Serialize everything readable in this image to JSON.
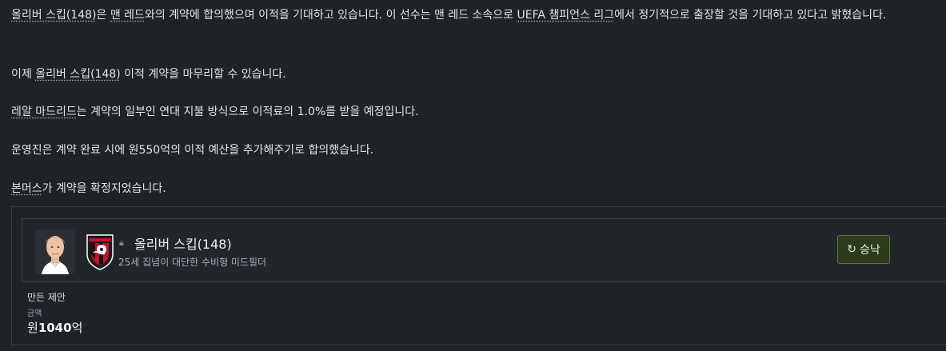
{
  "messages": {
    "p1": {
      "name": "올리버 스킵(148)",
      "tail_a": "은 ",
      "club": "맨 레드",
      "tail_b": "와의 계약에 합의했으며 이적을 기대하고 있습니다. 이 선수는 맨 레드 소속으로 ",
      "competition": "UEFA 챔피언스 리그",
      "tail_c": "에서 정기적으로 출장할 것을 기대하고 있다고 밝혔습니다."
    },
    "p2": {
      "head": "이제 ",
      "name": "올리버 스킵(148)",
      "tail": " 이적 계약을 마무리할 수 있습니다."
    },
    "p3": {
      "club": "레알 마드리드",
      "tail": "는 계약의 일부인 연대 지불 방식으로 이적료의 1.0%를 받을 예정입니다."
    },
    "p4": {
      "text": "운영진은 계약 완료 시에 원550억의 이적 예산을 추가해주기로 합의했습니다."
    },
    "p5": {
      "club": "본머스",
      "tail": "가 계약을 확정지었습니다."
    }
  },
  "card": {
    "player_name": "올리버 스킵(148)",
    "player_desc": "25세 집념이 대단한 수비형 미드필더",
    "accept_label": "승낙",
    "offer_title": "만든 제안",
    "amount_label": "금액",
    "amount_prefix": "원",
    "amount_value": "1040",
    "amount_suffix": "억"
  },
  "icons": {
    "lock": "lock-icon",
    "accept": "refresh-icon"
  },
  "colors": {
    "background": "#1f2227",
    "accept_bg": "#2d3a1c",
    "accept_border": "#5c7a2c",
    "club_red": "#c8102e"
  }
}
